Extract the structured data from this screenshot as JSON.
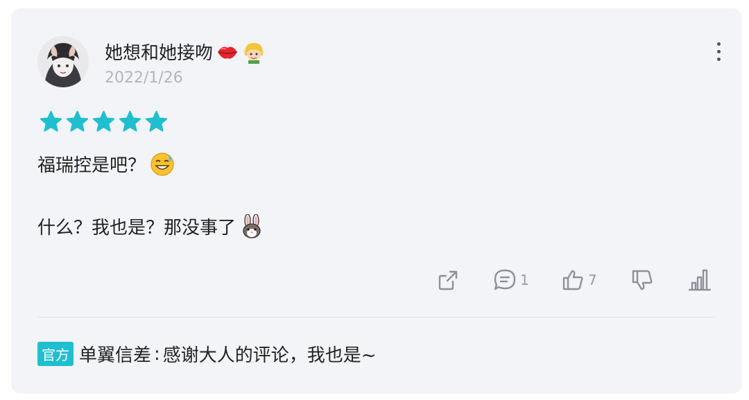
{
  "comment": {
    "username": "她想和她接吻",
    "username_emojis": [
      "lips-emoji",
      "elf-emoji"
    ],
    "date": "2022/1/26",
    "rating": 5,
    "rating_color": "#1fbfcf",
    "lines": [
      "福瑞控是吧？",
      "什么？我也是？那没事了"
    ],
    "line_emojis": [
      "sweat-smile-emoji",
      "rabbit-emoji"
    ]
  },
  "actions": {
    "share_icon": "share-icon",
    "comment_icon": "comment-icon",
    "comment_count": "1",
    "like_icon": "thumbs-up-icon",
    "like_count": "7",
    "dislike_icon": "thumbs-down-icon",
    "stats_icon": "bar-chart-icon"
  },
  "reply": {
    "badge": "官方",
    "badge_color": "#1fbfcf",
    "author": "单翼信差",
    "separator": ":",
    "text": "感谢大人的评论，我也是~"
  }
}
